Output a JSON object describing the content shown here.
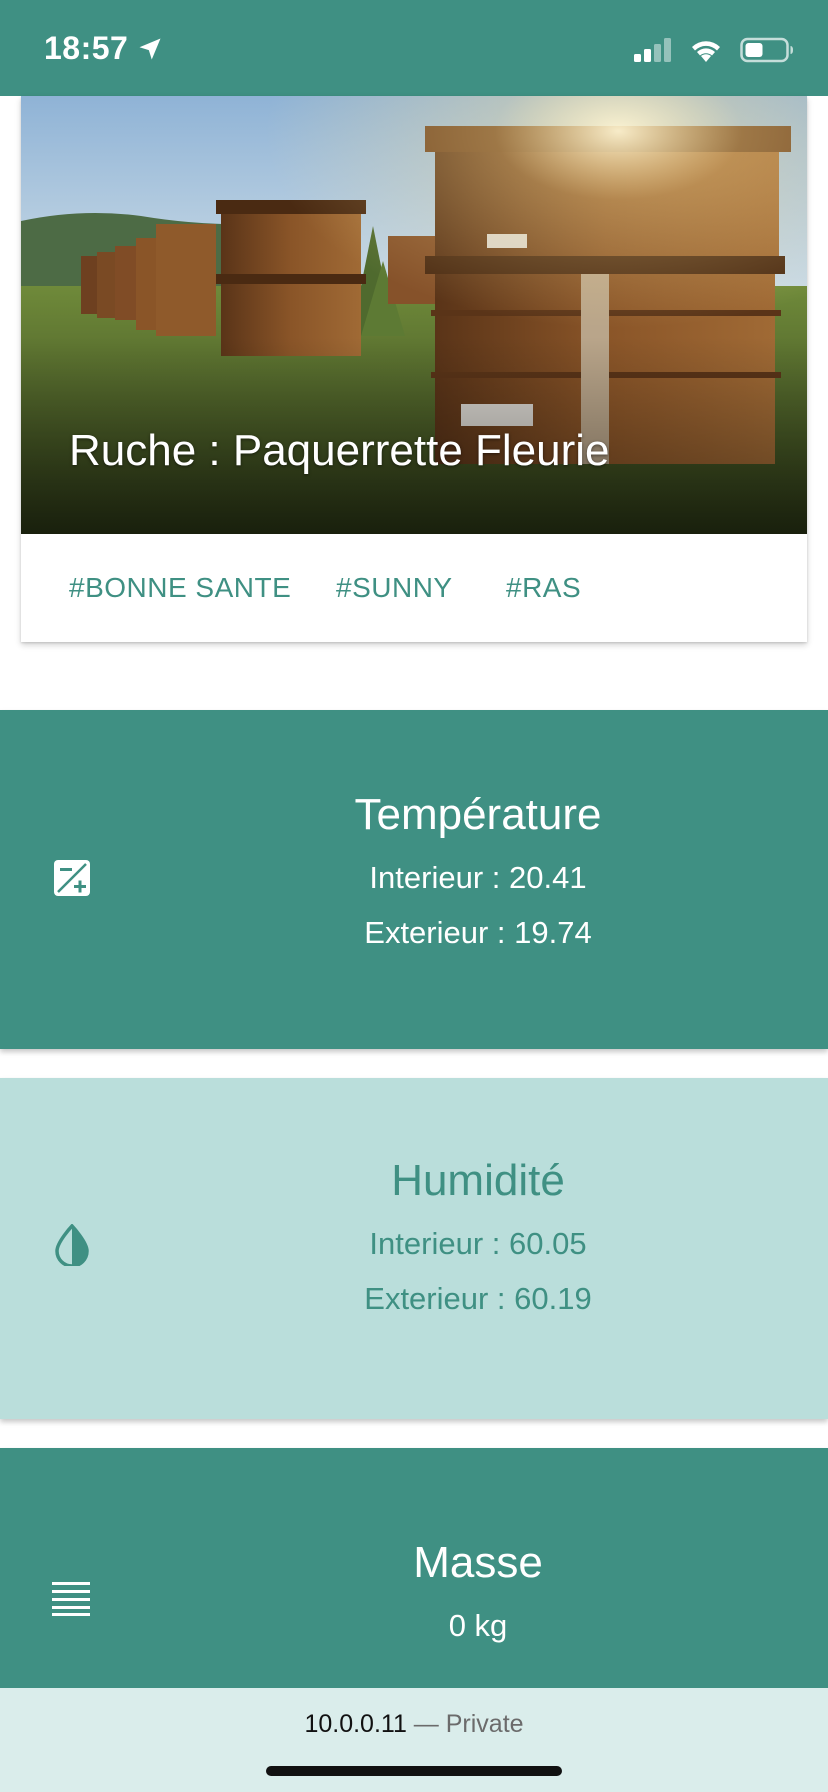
{
  "status_bar": {
    "time": "18:57",
    "icons": [
      "location-arrow-icon",
      "cellular-signal-icon",
      "wifi-icon",
      "battery-icon"
    ]
  },
  "hive_card": {
    "title": "Ruche : Paquerrette Fleurie",
    "image": "beehives-in-field-photo",
    "tags": [
      "#BONNE SANTE",
      "#SUNNY",
      "#RAS"
    ]
  },
  "temperature": {
    "icon": "exposure-plus-icon",
    "title": "Température",
    "interior": "Interieur : 20.41",
    "exterior": "Exterieur : 19.74"
  },
  "humidity": {
    "icon": "water-drop-icon",
    "title": "Humidité",
    "interior": "Interieur : 60.05",
    "exterior": "Exterieur : 60.19"
  },
  "mass": {
    "icon": "scale-lines-icon",
    "title": "Masse",
    "value": "0 kg"
  },
  "browser_bar": {
    "address": "10.0.0.11",
    "separator": " — ",
    "mode": "Private"
  },
  "colors": {
    "primary": "#3f9083",
    "light": "#badedb",
    "bottom_bar": "#daedeb"
  }
}
